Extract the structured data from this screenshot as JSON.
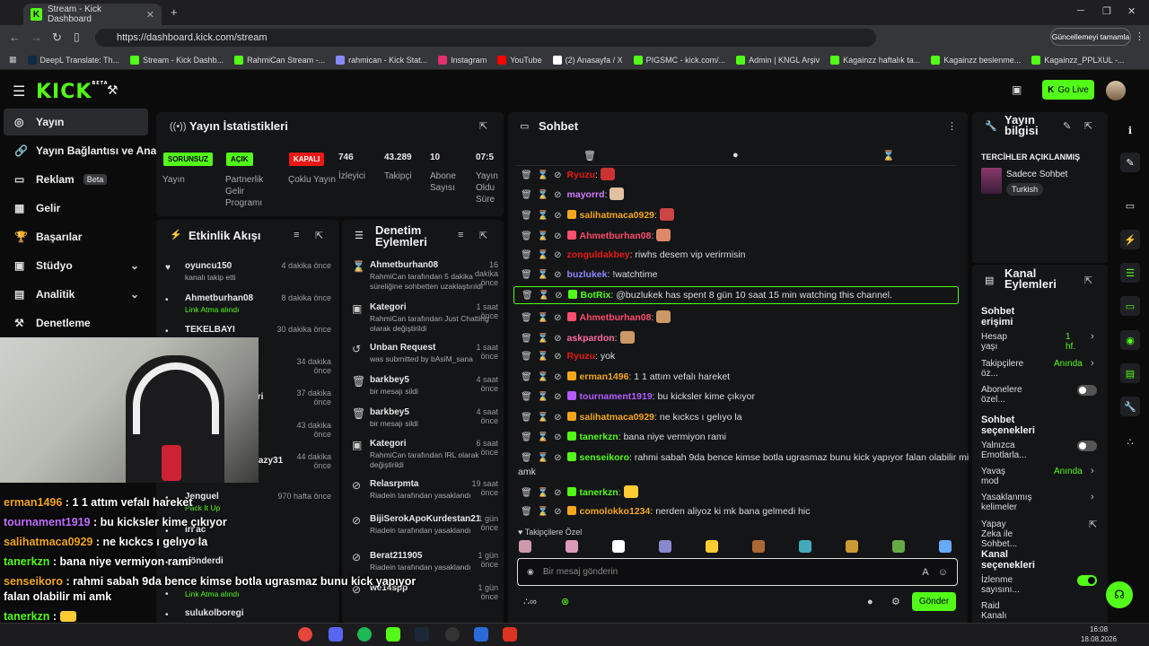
{
  "browser": {
    "tab_title": "Stream - Kick Dashboard",
    "url": "https://dashboard.kick.com/stream",
    "update_label": "Güncellemeyi tamamla",
    "bookmarks": [
      "DeepL Translate: Th...",
      "Stream - Kick Dashb...",
      "RahmiCan Stream -...",
      "rahmican - Kick Stat...",
      "Instagram",
      "YouTube",
      "(2) Anasayfa / X",
      "PIGSMC - kick.com/...",
      "Admin | KNGL Arşiv",
      "Kagainzz haftalık ta...",
      "Kagainzz beslenme...",
      "Kagainzz_PPLXUL -..."
    ]
  },
  "header": {
    "logo": "KICK",
    "logo_sup": "BETA",
    "go_live": "Go Live"
  },
  "sidebar": {
    "items": [
      "Yayın",
      "Yayın Bağlantısı ve Anahtar",
      "Reklam",
      "Gelir",
      "Başarılar",
      "Stüdyo",
      "Analitik",
      "Denetleme"
    ],
    "beta": "Beta"
  },
  "stats": {
    "title": "Yayın İstatistikleri",
    "badges": [
      {
        "text": "SORUNSUZ",
        "label": "Yayın",
        "color": "#53fc18"
      },
      {
        "text": "AÇIK",
        "label": "Partnerlik Gelir Programı",
        "color": "#53fc18"
      },
      {
        "text": "KAPALI",
        "label": "Çoklu Yayın",
        "color": "#e91916"
      }
    ],
    "numbers": [
      {
        "value": "746",
        "label": "İzleyici"
      },
      {
        "value": "43.289",
        "label": "Takipçi"
      },
      {
        "value": "10",
        "label": "Abone Sayısı"
      },
      {
        "value": "07:5",
        "label": "Yayın Oldu Süre"
      }
    ]
  },
  "activity": {
    "title": "Etkinlik Akışı",
    "items": [
      {
        "name": "oyuncu150",
        "desc": "kanalı takip etti",
        "time": "4 dakika önce"
      },
      {
        "name": "Ahmetburhan08",
        "desc": "Link Atma alındı",
        "time": "8 dakika önce"
      },
      {
        "name": "TEKELBAYI",
        "desc": "",
        "time": "30 dakika önce"
      },
      {
        "name": "",
        "desc": "",
        "time": "34 dakika önce"
      },
      {
        "name": "iri",
        "desc": "",
        "time": "37 dakika önce"
      },
      {
        "name": "",
        "desc": "",
        "time": "43 dakika önce"
      },
      {
        "name": "razy31",
        "desc": "",
        "time": "44 dakika önce"
      },
      {
        "name": "Jenguel",
        "desc": "Pack It Up",
        "time": "970 hafta önce"
      },
      {
        "name": "iri ac",
        "desc": "1.000",
        "time": ""
      },
      {
        "name": "gönderdi",
        "desc": "",
        "time": ""
      },
      {
        "name": "",
        "desc": "Link Atma alındı",
        "time": ""
      },
      {
        "name": "sulukolboregi",
        "desc": "",
        "time": ""
      }
    ]
  },
  "moderation": {
    "title": "Denetim Eylemleri",
    "items": [
      {
        "name": "Ahmetburhan08",
        "time": "16 dakika önce",
        "desc": "RahmiCan tarafından 5 dakika süreliğine sohbetten uzaklaştırıldı"
      },
      {
        "name": "Kategori",
        "time": "1 saat önce",
        "desc": "RahmiCan tarafından Just Chatting olarak değiştirildi"
      },
      {
        "name": "Unban Request",
        "time": "1 saat önce",
        "desc": "was submitted by bAsiM_sana"
      },
      {
        "name": "barkbey5",
        "time": "4 saat önce",
        "desc": "bir mesajı sildi"
      },
      {
        "name": "barkbey5",
        "time": "4 saat önce",
        "desc": "bir mesajı sildi"
      },
      {
        "name": "Kategori",
        "time": "6 saat önce",
        "desc": "RahmiCan tarafından IRL olarak değiştirildi"
      },
      {
        "name": "Relasrpmta",
        "time": "19 saat önce",
        "desc": "Riadein tarafından yasaklandı"
      },
      {
        "name": "BijiSerokApoKurdestan21",
        "time": "1 gün önce",
        "desc": "Riadein tarafından yasaklandı"
      },
      {
        "name": "Berat211905",
        "time": "1 gün önce",
        "desc": "Riadein tarafından yasaklandı"
      },
      {
        "name": "we14spp",
        "time": "1 gün önce",
        "desc": ""
      }
    ]
  },
  "chat": {
    "title": "Sohbet",
    "messages": [
      {
        "user": "Ryuzu",
        "color": "#e91916",
        "text": ""
      },
      {
        "user": "mayorrd",
        "color": "#d27cff",
        "text": ""
      },
      {
        "user": "salihatmaca0929",
        "color": "#f4a71c",
        "text": ""
      },
      {
        "user": "Ahmetburhan08",
        "color": "#ff4d6d",
        "text": ""
      },
      {
        "user": "zonguldakbey",
        "color": "#e91916",
        "text": "riwhs desem vip verirmisin"
      },
      {
        "user": "buzlukek",
        "color": "#8a8aff",
        "text": "!watchtime"
      },
      {
        "user": "BotRix",
        "color": "#53fc18",
        "text": "@buzlukek has spent 8 gün 10 saat 15 min watching this channel."
      },
      {
        "user": "Ahmetburhan08",
        "color": "#ff4d6d",
        "text": ""
      },
      {
        "user": "askpardon",
        "color": "#ff6b9d",
        "text": ""
      },
      {
        "user": "Ryuzu",
        "color": "#e91916",
        "text": "yok"
      },
      {
        "user": "erman1496",
        "color": "#f4a71c",
        "text": "1 1 attım vefalı hareket"
      },
      {
        "user": "tournament1919",
        "color": "#b35cff",
        "text": "bu kicksler kime çıkıyor"
      },
      {
        "user": "salihatmaca0929",
        "color": "#f4a71c",
        "text": "ne kıckcs ı gelıyo la"
      },
      {
        "user": "tanerkzn",
        "color": "#53fc18",
        "text": "bana niye vermiyon rami"
      },
      {
        "user": "senseikoro",
        "color": "#53fc18",
        "text": "rahmi sabah 9da bence kimse botla ugrasmaz bunu kick yapıyor falan olabilir mi"
      },
      {
        "user": "tanerkzn",
        "color": "#53fc18",
        "text": ""
      },
      {
        "user": "comolokko1234",
        "color": "#f4a71c",
        "text": "nerden aliyoz ki mk bana gelmedi hic"
      }
    ],
    "wrap_line": "amk",
    "followers_only": "Takipçilere Özel",
    "placeholder": "Bir mesaj gönderin",
    "send": "Gönder"
  },
  "stream_info": {
    "title": "Yayın bilgisi",
    "pref_label": "TERCİHLER AÇIKLANMIŞ",
    "category": "Sadece Sohbet",
    "language": "Turkish"
  },
  "channel_actions": {
    "title": "Kanal Eylemleri",
    "chat_access": "Sohbet erişimi",
    "rows": [
      {
        "label": "Hesap yaşı",
        "value": "1 hf."
      },
      {
        "label": "Takipçilere öz...",
        "value": "Anında"
      },
      {
        "label": "Abonelere özel...",
        "value": ""
      }
    ],
    "chat_options": "Sohbet seçenekleri",
    "rows2": [
      {
        "label": "Yalnızca Emotlarla...",
        "value": ""
      },
      {
        "label": "Yavaş mod",
        "value": "Anında"
      },
      {
        "label": "Yasaklanmış kelimeler",
        "value": ""
      },
      {
        "label": "Yapay Zeka ile Sohbet...",
        "value": ""
      }
    ],
    "channel_options": "Kanal seçenekleri",
    "rows3": [
      {
        "label": "İzlenme sayısını...",
        "value": ""
      },
      {
        "label": "Raid Kanalı",
        "value": ""
      }
    ]
  },
  "overlay": {
    "lines": [
      {
        "user": "erman1496",
        "color": "#f4a71c",
        "text": "1 1 attım vefalı hareket"
      },
      {
        "user": "tournament1919",
        "color": "#c070ff",
        "text": "bu kicksler kime çıkıyor"
      },
      {
        "user": "salihatmaca0929",
        "color": "#f4a71c",
        "text": "ne kıckcs ı gelıyo la"
      },
      {
        "user": "tanerkzn",
        "color": "#53fc18",
        "text": "bana niye vermiyon rami"
      },
      {
        "user": "senseikoro",
        "color": "#f4a71c",
        "text": "rahmi sabah 9da bence kimse botla ugrasmaz bunu kick yapıyor"
      },
      {
        "user": "",
        "color": "#fff",
        "text": "falan olabilir mi amk"
      },
      {
        "user": "tanerkzn",
        "color": "#53fc18",
        "text": ""
      },
      {
        "user": "comolokko1234",
        "color": "#f4a71c",
        "text": "nerden aliyoz ki mk bana gelmedi hic"
      }
    ]
  },
  "taskbar": {
    "time": "16:08",
    "date": "18.08.2026"
  }
}
